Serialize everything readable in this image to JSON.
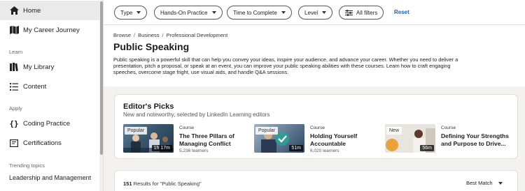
{
  "sidebar": {
    "items": [
      {
        "label": "Home",
        "icon": "home-icon"
      },
      {
        "label": "My Career Journey",
        "icon": "map-icon"
      },
      {
        "label": "My Library",
        "icon": "library-icon"
      },
      {
        "label": "Content",
        "icon": "list-icon"
      },
      {
        "label": "Coding Practice",
        "icon": "code-braces-icon"
      },
      {
        "label": "Certifications",
        "icon": "certificate-icon"
      }
    ],
    "sections": {
      "learn": "Learn",
      "apply": "Apply",
      "trending": "Trending topics"
    },
    "trending_item": "Leadership and Management"
  },
  "filters": {
    "pills": [
      "Type",
      "Hands-On Practice",
      "Time to Complete",
      "Level",
      "All filters"
    ],
    "reset": "Reset"
  },
  "breadcrumb": [
    "Browse",
    "Business",
    "Professional Development"
  ],
  "page_title": "Public Speaking",
  "description": "Public speaking is a powerful skill that can help you convey your ideas, inspire your audience, and advance your career. Whether you need to deliver a presentation, pitch a proposal, or speak at an event, you can improve your public speaking abilities with these courses. Learn how to craft engaging speeches, overcome stage fright, use visual aids, and handle Q&A sessions.",
  "editors_picks": {
    "title": "Editor's Picks",
    "subtitle": "New and noteworthy, selected by LinkedIn Learning editors",
    "courses": [
      {
        "badge": "Popular",
        "duration": "1h 17m",
        "type": "Course",
        "title": "The Three Pillars of Managing Conflict",
        "learners": "5,236 learners"
      },
      {
        "badge": "Popular",
        "duration": "51m",
        "type": "Course",
        "title": "Holding Yourself Accountable",
        "learners": "6,020 learners"
      },
      {
        "badge": "New",
        "duration": "56m",
        "type": "Course",
        "title": "Defining Your Strengths and Purpose to Drive...",
        "learners": ""
      }
    ]
  },
  "results": {
    "count": "151",
    "label": "Results for \"Public Speaking\"",
    "sort": "Best Match"
  },
  "colors": {
    "accent": "#0a66c2",
    "background": "#f3f2ef"
  }
}
